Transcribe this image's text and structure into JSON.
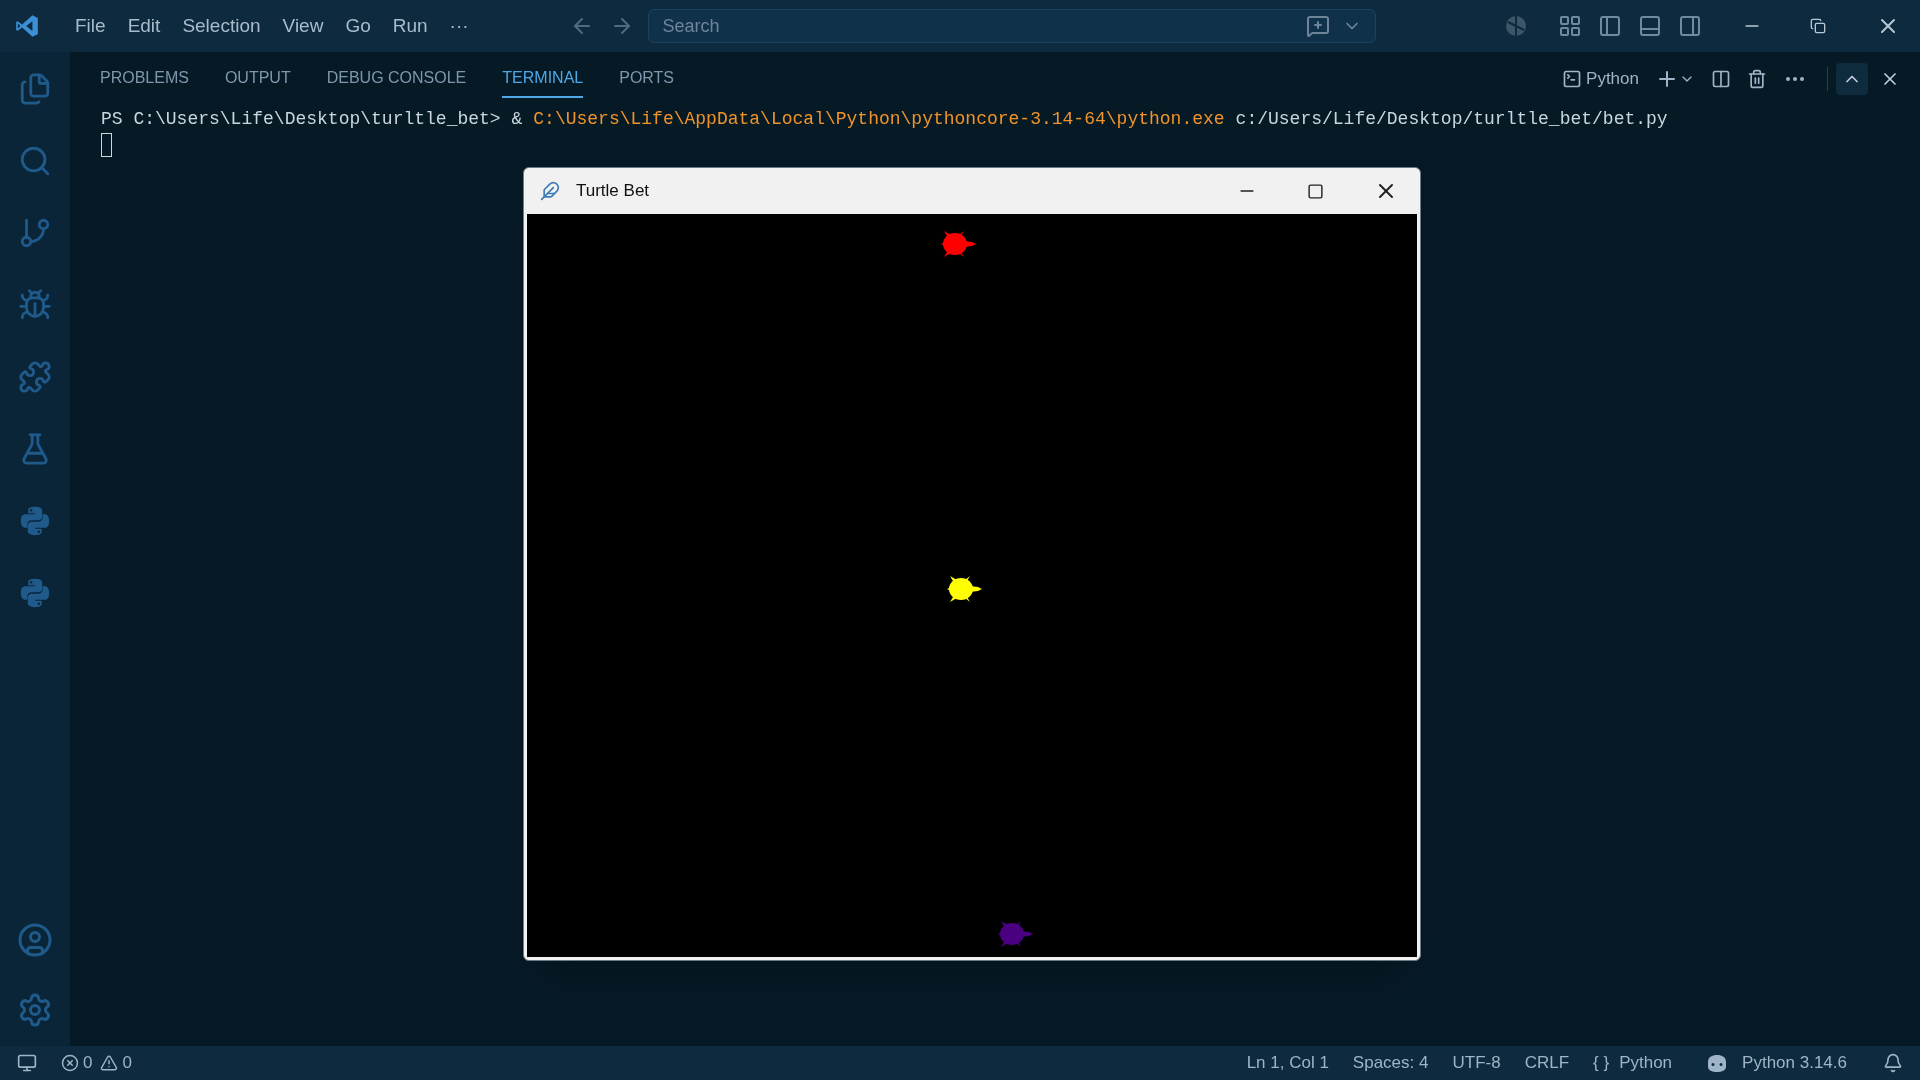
{
  "menu": [
    "File",
    "Edit",
    "Selection",
    "View",
    "Go",
    "Run",
    "···"
  ],
  "search": {
    "placeholder": "Search"
  },
  "activity_bar": [
    {
      "kind": "files",
      "selected": false
    },
    {
      "kind": "search",
      "selected": false
    },
    {
      "kind": "branch",
      "selected": false
    },
    {
      "kind": "debug",
      "selected": false
    },
    {
      "kind": "extensions",
      "selected": false
    },
    {
      "kind": "flask",
      "selected": false
    },
    {
      "kind": "python",
      "selected": false
    },
    {
      "kind": "python",
      "selected": false
    }
  ],
  "panel_tabs": [
    {
      "label": "PROBLEMS",
      "selected": false
    },
    {
      "label": "OUTPUT",
      "selected": false
    },
    {
      "label": "DEBUG CONSOLE",
      "selected": false
    },
    {
      "label": "TERMINAL",
      "selected": true
    },
    {
      "label": "PORTS",
      "selected": false
    }
  ],
  "terminal_profile": "Python",
  "terminal": {
    "prompt": "PS C:\\Users\\Life\\Desktop\\turltle_bet> &",
    "executable": "C:\\Users\\Life\\AppData\\Local\\Python\\pythoncore-3.14-64\\python.exe",
    "argument": "c:/Users/Life/Desktop/turltle_bet/bet.py"
  },
  "turtle_window": {
    "title": "Turtle Bet",
    "turtles": [
      {
        "color": "#ff0000"
      },
      {
        "color": "#ffff00"
      },
      {
        "color": "#4b0082"
      }
    ]
  },
  "status_bar": {
    "errors": "0",
    "warnings": "0",
    "position": "Ln 1, Col 1",
    "spaces": "Spaces: 4",
    "encoding": "UTF-8",
    "eol": "CRLF",
    "language": "Python",
    "braces": "{ }",
    "interpreter": "Python 3.14.6"
  }
}
